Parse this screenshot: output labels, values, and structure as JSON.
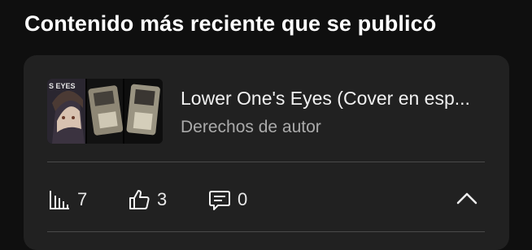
{
  "section": {
    "title": "Contenido más reciente que se publicó"
  },
  "video": {
    "title": "Lower One's Eyes (Cover en esp...",
    "subtitle": "Derechos de autor",
    "thumbnail_text": "S EYES"
  },
  "stats": {
    "views": "7",
    "likes": "3",
    "comments": "0"
  },
  "icons": {
    "views": "bar-chart-icon",
    "likes": "thumbs-up-icon",
    "comments": "comment-icon",
    "expand": "chevron-up-icon"
  },
  "colors": {
    "background": "#0f0f0f",
    "card": "#212121",
    "text_primary": "#f1f1f1",
    "text_secondary": "#aaaaaa"
  }
}
